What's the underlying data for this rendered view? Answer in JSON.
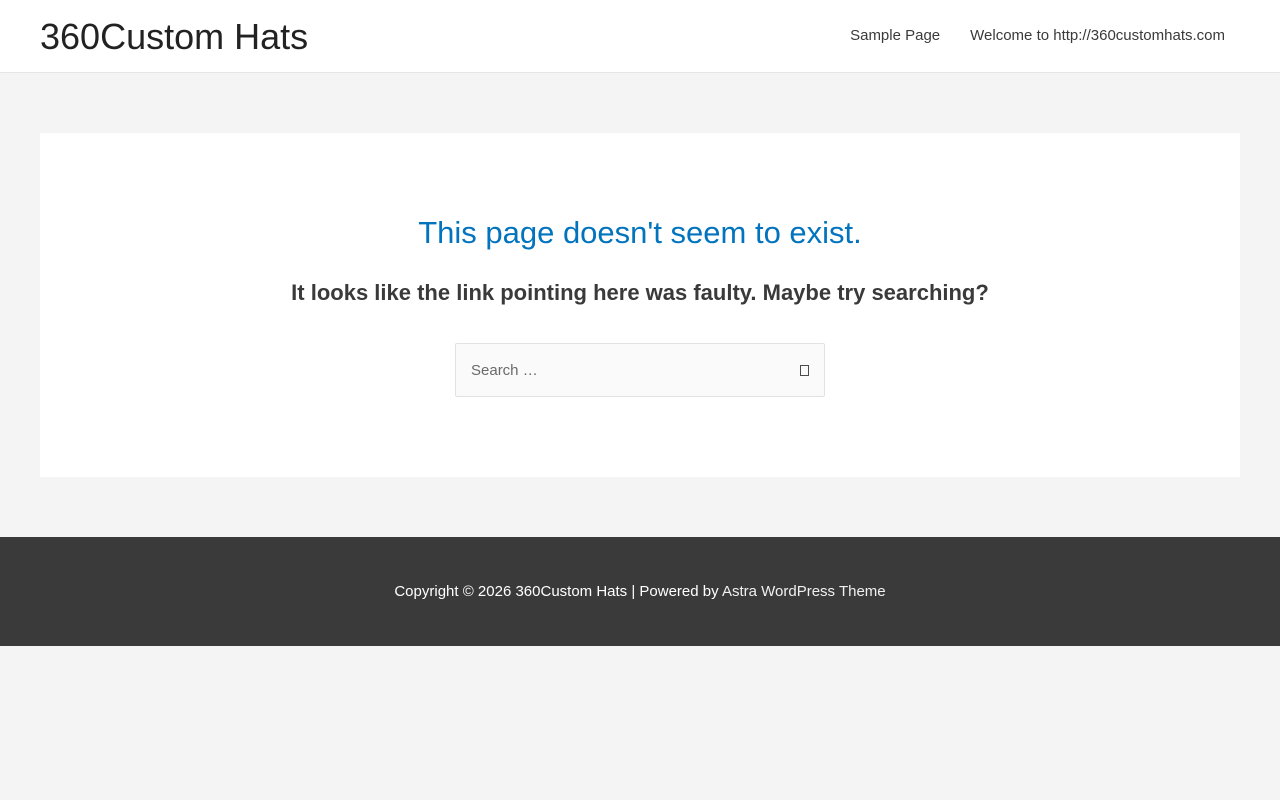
{
  "header": {
    "site_title": "360Custom Hats",
    "nav": [
      {
        "label": "Sample Page"
      },
      {
        "label": "Welcome to http://360customhats.com"
      }
    ]
  },
  "main": {
    "title": "This page doesn't seem to exist.",
    "subtitle": "It looks like the link pointing here was faulty. Maybe try searching?",
    "search": {
      "placeholder": "Search …",
      "value": "",
      "submit_icon": "search-submit-glyph"
    }
  },
  "footer": {
    "copyright_prefix": "Copyright © 2026 360Custom Hats | Powered by ",
    "theme_link": "Astra WordPress Theme"
  },
  "colors": {
    "accent": "#0274be",
    "footer_bg": "#3a3a3a",
    "page_bg": "#f4f4f4"
  }
}
